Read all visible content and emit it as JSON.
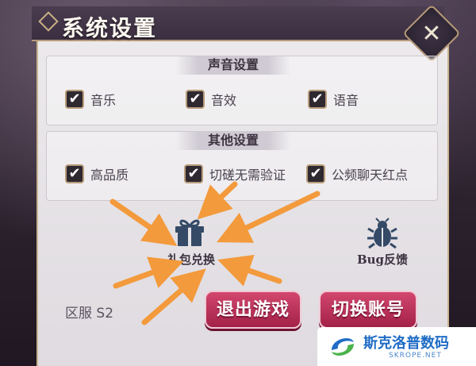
{
  "title": "系统设置",
  "sound_section": {
    "heading": "声音设置",
    "options": [
      {
        "label": "音乐",
        "checked": true
      },
      {
        "label": "音效",
        "checked": true
      },
      {
        "label": "语音",
        "checked": true
      }
    ]
  },
  "other_section": {
    "heading": "其他设置",
    "options": [
      {
        "label": "高品质",
        "checked": true
      },
      {
        "label": "切磋无需验证",
        "checked": true
      },
      {
        "label": "公频聊天红点",
        "checked": true
      }
    ]
  },
  "actions": {
    "gift_label": "礼包兑换",
    "bug_label": "Bug反馈"
  },
  "server": "区服  S2",
  "buttons": {
    "exit": "退出游戏",
    "switch_account": "切换账号"
  },
  "checkmark": "✔",
  "close_glyph": "✕",
  "watermark": {
    "name": "斯克洛普数码",
    "site": "SKROPE.NET"
  },
  "colors": {
    "accent_pink": "#c8355f",
    "arrow_orange": "#f39a3c",
    "panel": "#e6e3e7",
    "frame_gold": "#b69a77"
  },
  "icons": [
    "gift-icon",
    "bug-icon",
    "close-icon",
    "checkbox-check-icon",
    "watermark-logo-icon"
  ]
}
